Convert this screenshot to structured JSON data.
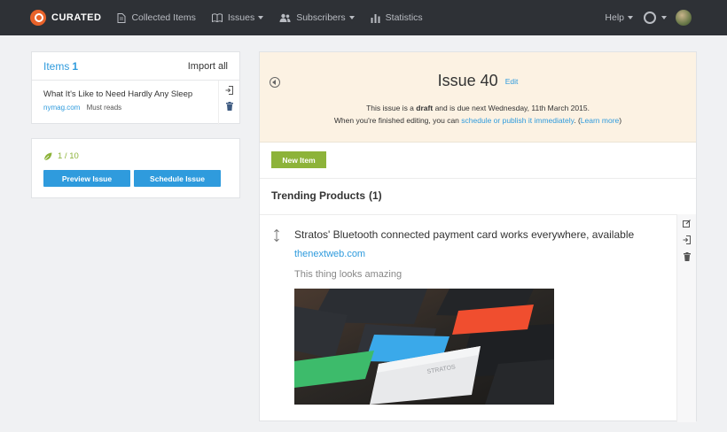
{
  "nav": {
    "brand": "CURATED",
    "collected_items": "Collected Items",
    "issues": "Issues",
    "subscribers": "Subscribers",
    "statistics": "Statistics",
    "help": "Help"
  },
  "items_panel": {
    "title": "Items",
    "count": "1",
    "import_all": "Import all",
    "items": [
      {
        "title": "What It's Like to Need Hardly Any Sleep",
        "source": "nymag.com",
        "tag": "Must reads"
      }
    ]
  },
  "progress_panel": {
    "progress": "1 / 10",
    "preview_label": "Preview Issue",
    "schedule_label": "Schedule Issue"
  },
  "issue": {
    "title": "Issue 40",
    "edit": "Edit",
    "line1_pre": "This issue is a",
    "line1_bold": "draft",
    "line1_post": "and is due next Wednesday, 11th March 2015.",
    "line2_pre": "When you're finished editing, you can",
    "line2_link": "schedule or publish it immediately",
    "line2_mid": ". (",
    "line2_learn": "Learn more",
    "line2_post": ")",
    "new_item": "New Item"
  },
  "section": {
    "title": "Trending Products",
    "count": "(1)",
    "entry": {
      "title": "Stratos' Bluetooth connected payment card works everywhere, available",
      "source": "thenextweb.com",
      "comment": "This thing looks amazing"
    }
  },
  "colors": {
    "navbar": "#2e3136",
    "accent_blue": "#2f9bdd",
    "accent_green": "#8db33a",
    "brand_orange": "#e8622a",
    "header_bg": "#fcf2e3"
  }
}
